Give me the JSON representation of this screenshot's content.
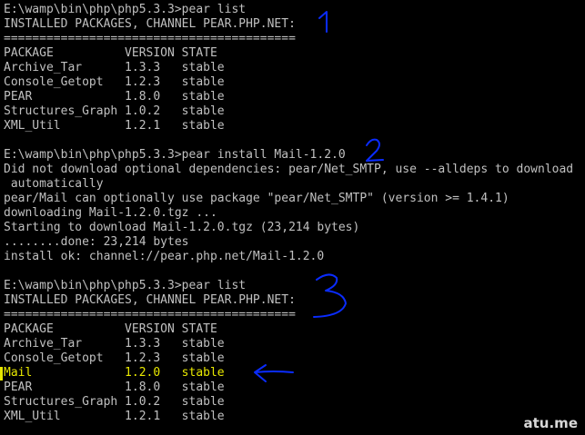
{
  "terminal": {
    "lines": [
      "E:\\wamp\\bin\\php\\php5.3.3>pear list",
      "INSTALLED PACKAGES, CHANNEL PEAR.PHP.NET:",
      "=========================================",
      "PACKAGE          VERSION STATE",
      "Archive_Tar      1.3.3   stable",
      "Console_Getopt   1.2.3   stable",
      "PEAR             1.8.0   stable",
      "Structures_Graph 1.0.2   stable",
      "XML_Util         1.2.1   stable",
      "",
      "E:\\wamp\\bin\\php\\php5.3.3>pear install Mail-1.2.0",
      "Did not download optional dependencies: pear/Net_SMTP, use --alldeps to download",
      " automatically",
      "pear/Mail can optionally use package \"pear/Net_SMTP\" (version >= 1.4.1)",
      "downloading Mail-1.2.0.tgz ...",
      "Starting to download Mail-1.2.0.tgz (23,214 bytes)",
      "........done: 23,214 bytes",
      "install ok: channel://pear.php.net/Mail-1.2.0",
      "",
      "E:\\wamp\\bin\\php\\php5.3.3>pear list",
      "INSTALLED PACKAGES, CHANNEL PEAR.PHP.NET:",
      "=========================================",
      "PACKAGE          VERSION STATE",
      "Archive_Tar      1.3.3   stable",
      "Console_Getopt   1.2.3   stable",
      "Mail             1.2.0   stable",
      "PEAR             1.8.0   stable",
      "Structures_Graph 1.0.2   stable",
      "XML_Util         1.2.1   stable"
    ],
    "highlighted_line_index": 25,
    "text_color": "#c0c0c0",
    "highlight_color": "#e8e800",
    "background_color": "#000000"
  },
  "annotations": {
    "marker_color": "#0a2cff",
    "marker_icons": [
      "number-1-annotation",
      "number-2-annotation",
      "number-3-annotation",
      "left-arrow-annotation"
    ]
  },
  "watermark": {
    "text": "atu.me"
  }
}
